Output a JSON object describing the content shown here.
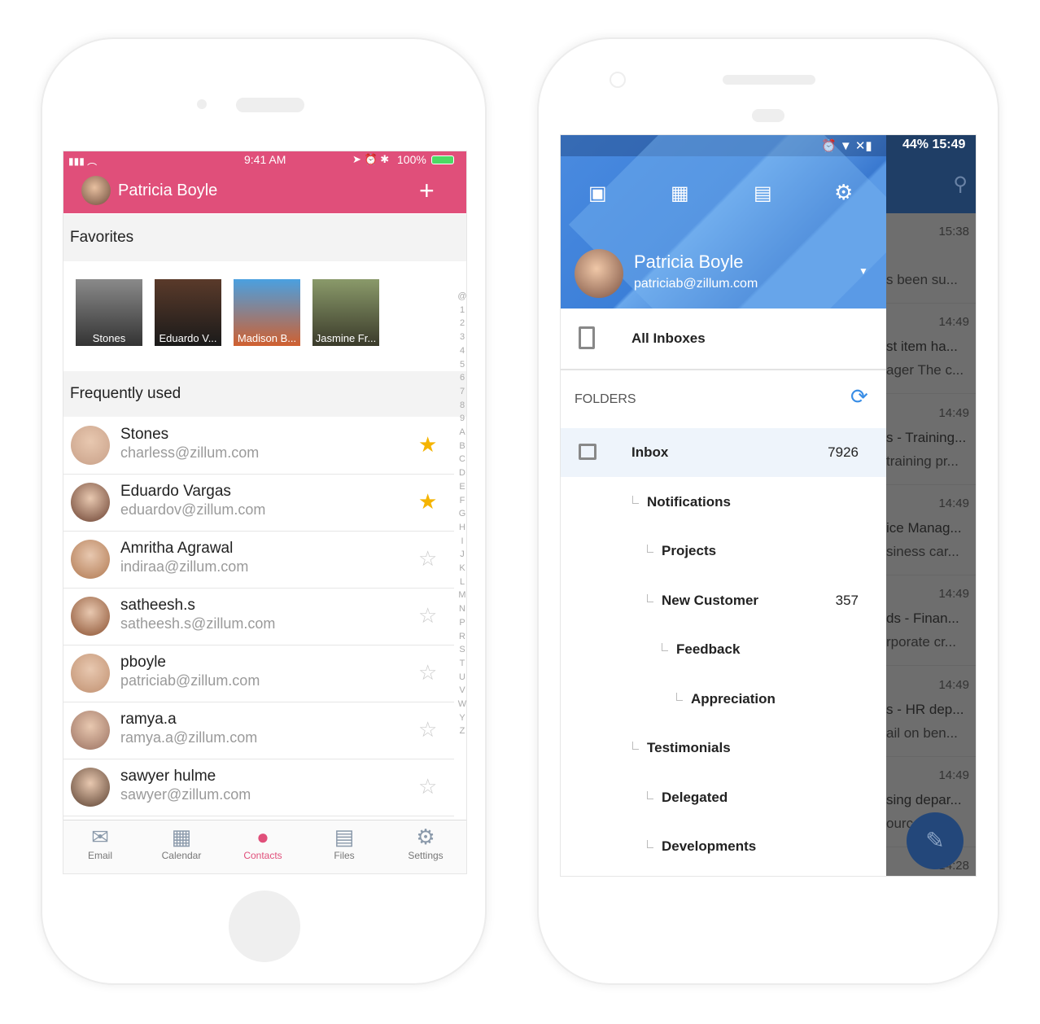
{
  "left": {
    "status": {
      "time": "9:41 AM",
      "battery": "100%"
    },
    "header": {
      "user": "Patricia Boyle",
      "add": "+"
    },
    "favorites_label": "Favorites",
    "favorites": [
      "Stones",
      "Eduardo V...",
      "Madison B...",
      "Jasmine Fr..."
    ],
    "frequent_label": "Frequently used",
    "contacts": [
      {
        "name": "Stones",
        "email": "charless@zillum.com",
        "starred": true
      },
      {
        "name": "Eduardo Vargas",
        "email": "eduardov@zillum.com",
        "starred": true
      },
      {
        "name": "Amritha Agrawal",
        "email": "indiraa@zillum.com",
        "starred": false
      },
      {
        "name": "satheesh.s",
        "email": "satheesh.s@zillum.com",
        "starred": false
      },
      {
        "name": "pboyle",
        "email": "patriciab@zillum.com",
        "starred": false
      },
      {
        "name": "ramya.a",
        "email": "ramya.a@zillum.com",
        "starred": false
      },
      {
        "name": "sawyer hulme",
        "email": "sawyer@zillum.com",
        "starred": false
      }
    ],
    "index": [
      "@",
      "1",
      "2",
      "3",
      "4",
      "5",
      "6",
      "7",
      "8",
      "9",
      "A",
      "B",
      "C",
      "D",
      "E",
      "F",
      "G",
      "H",
      "I",
      "J",
      "K",
      "L",
      "M",
      "N",
      "P",
      "R",
      "S",
      "T",
      "U",
      "V",
      "W",
      "Y",
      "Z"
    ],
    "tabs": [
      {
        "label": "Email",
        "icon": "envelope-icon"
      },
      {
        "label": "Calendar",
        "icon": "calendar-icon"
      },
      {
        "label": "Contacts",
        "icon": "contact-icon",
        "active": true
      },
      {
        "label": "Files",
        "icon": "file-icon"
      },
      {
        "label": "Settings",
        "icon": "gear-icon"
      }
    ],
    "accent": "#e04f7a"
  },
  "right": {
    "status": {
      "battery": "44%",
      "time": "15:49"
    },
    "user": {
      "name": "Patricia Boyle",
      "email": "patriciab@zillum.com"
    },
    "all_inboxes": "All Inboxes",
    "folders_label": "FOLDERS",
    "folders": [
      {
        "name": "Inbox",
        "count": "7926",
        "level": 0
      },
      {
        "name": "Notifications",
        "count": "",
        "level": 1
      },
      {
        "name": "Projects",
        "count": "",
        "level": 2
      },
      {
        "name": "New Customer",
        "count": "357",
        "level": 2
      },
      {
        "name": "Feedback",
        "count": "",
        "level": 3
      },
      {
        "name": "Appreciation",
        "count": "",
        "level": 4
      },
      {
        "name": "Testimonials",
        "count": "",
        "level": 1
      },
      {
        "name": "Delegated",
        "count": "",
        "level": 2
      },
      {
        "name": "Developments",
        "count": "",
        "level": 2
      }
    ],
    "mails": [
      {
        "time": "15:38",
        "a": "",
        "b": "s been su..."
      },
      {
        "time": "14:49",
        "a": "st item ha...",
        "b": "ager The c..."
      },
      {
        "time": "14:49",
        "a": "s - Training...",
        "b": "training pr..."
      },
      {
        "time": "14:49",
        "a": "ice Manag...",
        "b": "siness car..."
      },
      {
        "time": "14:49",
        "a": "ds - Finan...",
        "b": "rporate cr..."
      },
      {
        "time": "14:49",
        "a": "s - HR dep...",
        "b": "ail on ben..."
      },
      {
        "time": "14:49",
        "a": "sing depar...",
        "b": "ourc"
      },
      {
        "time": "14:28",
        "a": "",
        "b": ""
      }
    ],
    "accent": "#3a7bd5"
  }
}
